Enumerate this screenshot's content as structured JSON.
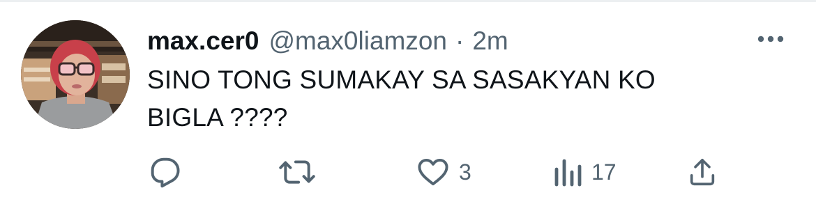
{
  "tweet": {
    "display_name": "max.cer0",
    "handle": "@max0liamzon",
    "separator": "·",
    "time": "2m",
    "text": "SINO TONG SUMAKAY SA SASAKYAN KO\nBIGLA ????"
  },
  "actions": {
    "reply": {
      "icon": "reply-icon",
      "count": ""
    },
    "retweet": {
      "icon": "retweet-icon",
      "count": ""
    },
    "like": {
      "icon": "heart-icon",
      "count": "3"
    },
    "views": {
      "icon": "views-icon",
      "count": "17"
    },
    "share": {
      "icon": "share-icon",
      "count": ""
    }
  },
  "colors": {
    "text_primary": "#0f1419",
    "text_secondary": "#536471",
    "divider": "#eceff1"
  }
}
